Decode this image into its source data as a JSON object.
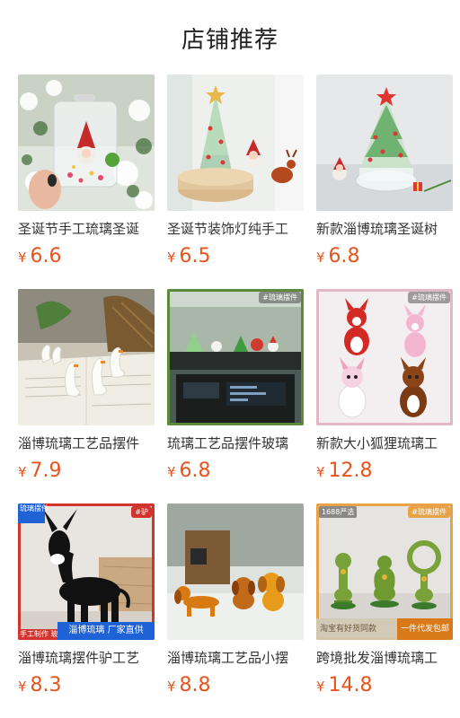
{
  "page": {
    "title": "店铺推荐"
  },
  "products": [
    {
      "name": "圣诞节手工琉璃圣诞",
      "currency": "¥",
      "price": "6.6",
      "image": "snow-keychain-photo"
    },
    {
      "name": "圣诞节装饰灯纯手工",
      "currency": "¥",
      "price": "6.5",
      "image": "tree-lamp-photo"
    },
    {
      "name": "新款淄博琉璃圣诞树",
      "currency": "¥",
      "price": "6.8",
      "image": "glass-tree-photo"
    },
    {
      "name": "淄博琉璃工艺品摆件",
      "currency": "¥",
      "price": "7.9",
      "image": "glass-swans-photo"
    },
    {
      "name": "琉璃工艺品摆件玻璃",
      "currency": "¥",
      "price": "6.8",
      "image": "car-dash-photo",
      "tag_tr": "#琉璃摆件"
    },
    {
      "name": "新款大小狐狸琉璃工",
      "currency": "¥",
      "price": "12.8",
      "image": "glass-foxes-photo",
      "tag_tr": "#琉璃摆件"
    },
    {
      "name": "淄博琉璃摆件驴工艺",
      "currency": "¥",
      "price": "8.3",
      "image": "glass-donkey-photo",
      "tag_tr": "#驴",
      "tag_tl": "琉璃摆件",
      "tag_bl": "手工制作 玻璃动物",
      "banner": "淄博琉璃 厂家直供"
    },
    {
      "name": "淄博琉璃工艺品小摆",
      "currency": "¥",
      "price": "8.8",
      "image": "glass-dogs-photo"
    },
    {
      "name": "跨境批发淄博琉璃工",
      "currency": "¥",
      "price": "14.8",
      "image": "glass-frogs-photo",
      "tag_tr": "#琉璃摆件",
      "badge": "1688严选",
      "strip_left": "淘宝有好货同款",
      "strip_right": "一件代发包邮"
    }
  ]
}
